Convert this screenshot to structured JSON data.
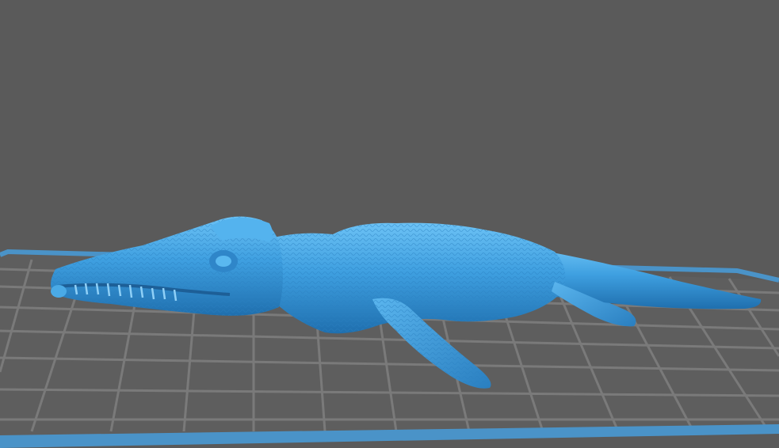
{
  "viewport": {
    "background_color": "#595959",
    "bed_surface_color": "#5e5e5e",
    "bed_grid_color": "#7a7a7a",
    "bed_border_color": "#4a93c8",
    "model_color": "#3e9fe0",
    "model_shadow_color": "#1f6fae",
    "model_highlight_color": "#6cc2f5",
    "model_icon": "crocodile-model-icon"
  }
}
